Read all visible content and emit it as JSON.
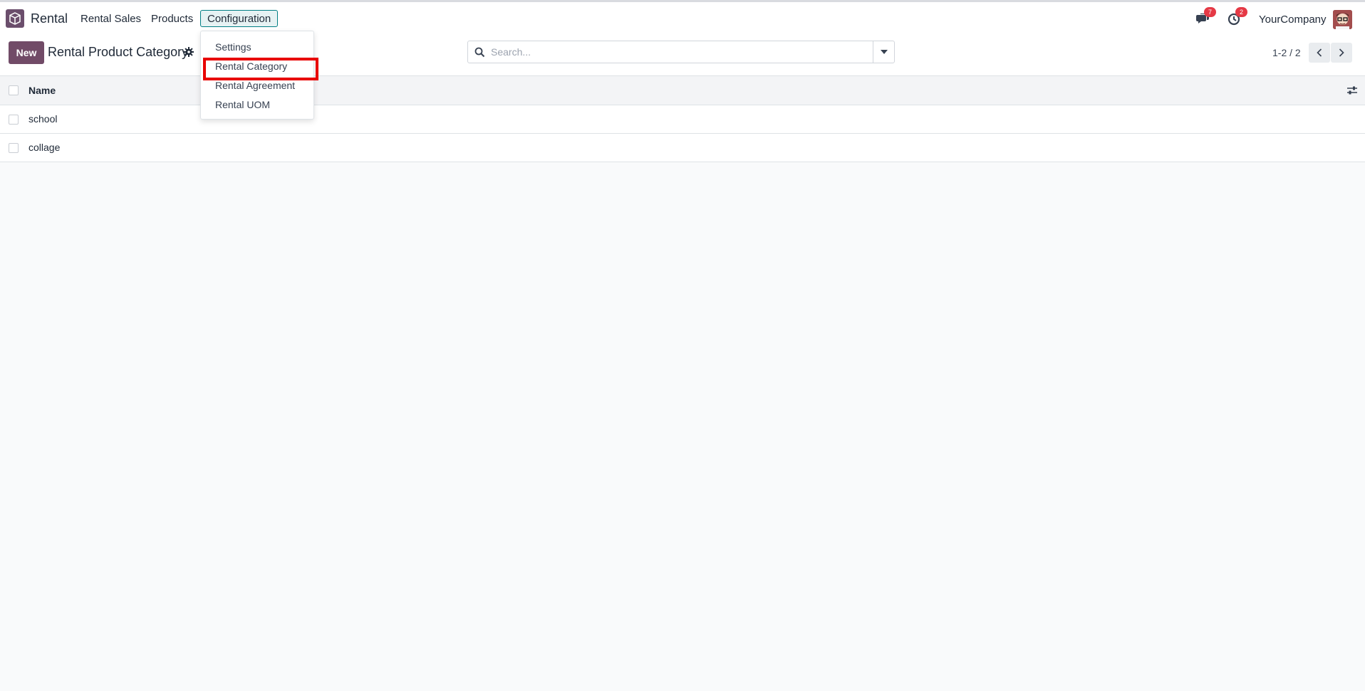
{
  "navbar": {
    "app_name": "Rental",
    "menu": [
      {
        "label": "Rental Sales"
      },
      {
        "label": "Products"
      },
      {
        "label": "Configuration"
      }
    ],
    "messages_count": "7",
    "activities_count": "2",
    "company": "YourCompany"
  },
  "control_panel": {
    "new_label": "New",
    "title": "Rental Product Category",
    "search_placeholder": "Search...",
    "pager": "1-2 / 2"
  },
  "table": {
    "columns": [
      "Name"
    ],
    "rows": [
      {
        "name": "school"
      },
      {
        "name": "collage"
      }
    ]
  },
  "config_dropdown": {
    "items": [
      {
        "label": "Settings"
      },
      {
        "label": "Rental Category"
      },
      {
        "label": "Rental Agreement"
      },
      {
        "label": "Rental UOM"
      }
    ],
    "highlighted": "Rental Category"
  },
  "colors": {
    "brand": "#714b67",
    "active_menu_border": "#017e84",
    "highlight": "#e80000",
    "badge": "#e53945"
  },
  "icons": [
    "rental-app-icon",
    "chat-icon",
    "clock-icon",
    "gear-icon",
    "search-icon",
    "caret-down-icon",
    "chevron-left-icon",
    "chevron-right-icon",
    "column-settings-icon",
    "avatar"
  ]
}
